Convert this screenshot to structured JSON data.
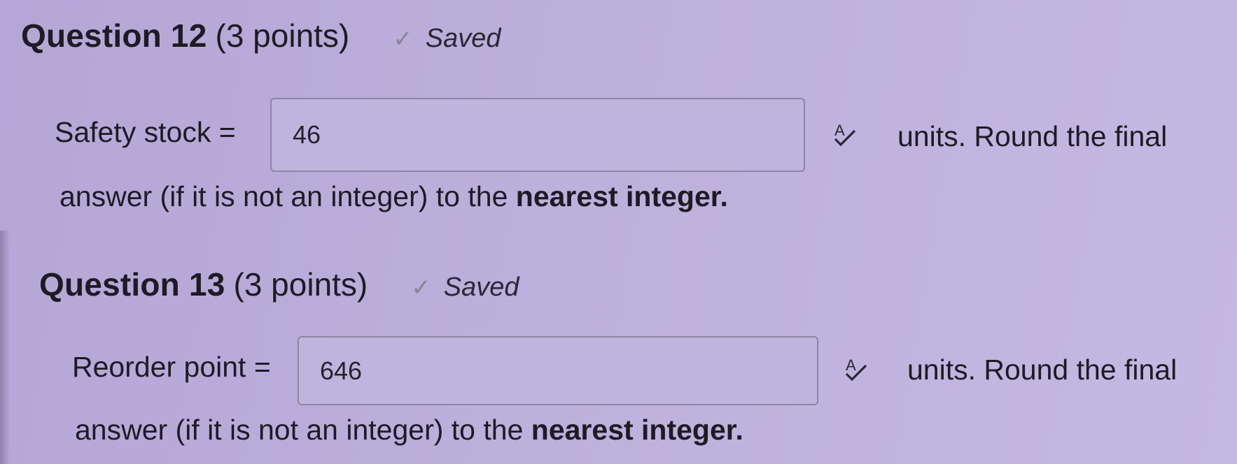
{
  "q12": {
    "title": "Question 12",
    "points": "(3 points)",
    "saved": "Saved",
    "prompt": "Safety stock =",
    "value": "46",
    "suffix": "units. Round the final",
    "cont_prefix": "answer (if it is not an integer) to the",
    "cont_bold": "nearest integer."
  },
  "q13": {
    "title": "Question 13",
    "points": "(3 points)",
    "saved": "Saved",
    "prompt": "Reorder point =",
    "value": "646",
    "suffix": "units. Round the final",
    "cont_prefix": "answer (if it is not an integer) to the",
    "cont_bold": "nearest integer."
  },
  "icons": {
    "saved": "check-icon",
    "spellcheck": "spellcheck-icon"
  }
}
